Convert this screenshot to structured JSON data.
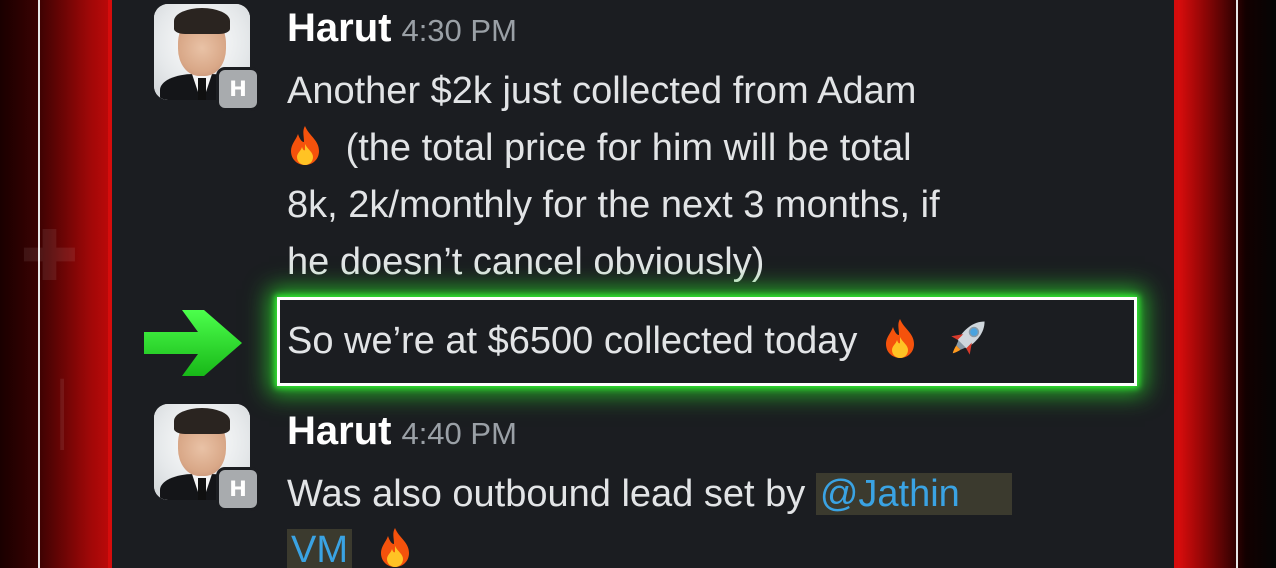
{
  "conversation": {
    "messages": [
      {
        "author": "Harut",
        "time": "4:30 PM",
        "avatar_badge": "H",
        "lines": [
          "Another $2k just collected from Adam",
          "(the total price for him will be total",
          "8k, 2k/monthly for the next 3 months, if",
          "he doesn’t cancel obviously)"
        ],
        "highlight_line": "So we’re at $6500 collected today",
        "emojis": [
          "fire-icon",
          "rocket-icon"
        ]
      },
      {
        "author": "Harut",
        "time": "4:40 PM",
        "avatar_badge": "H",
        "text_before_mention": "Was also outbound lead set by ",
        "mention_part1": "@Jathin",
        "mention_part2": "VM",
        "emojis": [
          "fire-icon"
        ]
      }
    ]
  },
  "colors": {
    "panel_bg": "#1b1d21",
    "frame_red": "#d50c0c",
    "highlight_glow": "#39ff39",
    "arrow_green": "#2ee62e",
    "mention_text": "#3aa3e3",
    "mention_bg": "#3b3a2e"
  }
}
